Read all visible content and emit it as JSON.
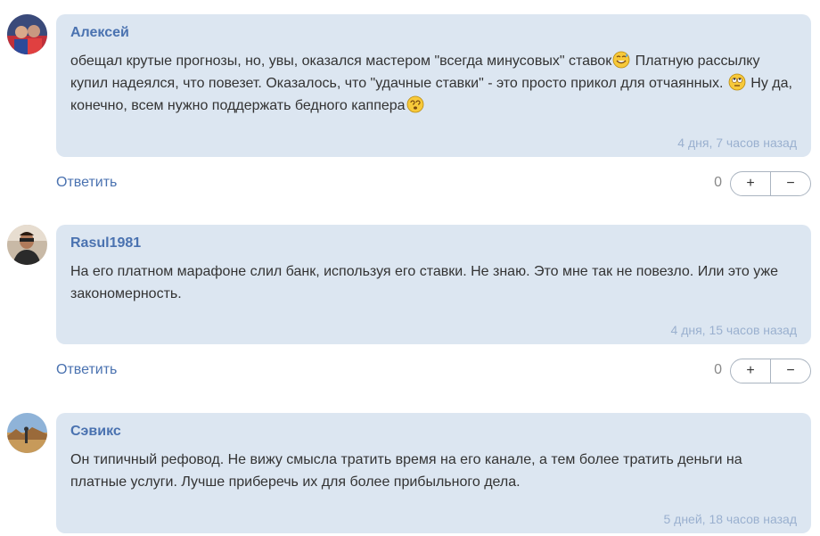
{
  "comments": [
    {
      "author": "Алексей",
      "text_parts": [
        "обещал крутые прогнозы, но, увы, оказался мастером \"всегда минусовых\" ставок",
        " Платную рассылку купил надеялся, что повезет. Оказалось, что \"удачные ставки\" - это просто прикол для отчаянных. ",
        " Ну да, конечно, всем нужно поддержать бедного каппера"
      ],
      "emojis": [
        "sweat-smile-emoji",
        "rolling-eyes-emoji",
        "dizzy-face-emoji"
      ],
      "time": "4 дня, 7 часов назад",
      "reply_label": "Ответить",
      "votes": "0",
      "plus": "+",
      "minus": "−"
    },
    {
      "author": "Rasul1981",
      "text": "На его платном марафоне слил банк, используя его ставки. Не знаю. Это мне так не повезло. Или это уже закономерность.",
      "time": "4 дня, 15 часов назад",
      "reply_label": "Ответить",
      "votes": "0",
      "plus": "+",
      "minus": "−"
    },
    {
      "author": "Сэвикс",
      "text": "Он типичный рефовод. Не вижу смысла тратить время на его канале, а тем более тратить деньги на платные услуги. Лучше приберечь их для более прибыльного дела.",
      "time": "5 дней, 18 часов назад"
    }
  ],
  "colors": {
    "bubble": "#dce6f1",
    "author": "#4a72b0",
    "time": "#9ab0cf"
  }
}
